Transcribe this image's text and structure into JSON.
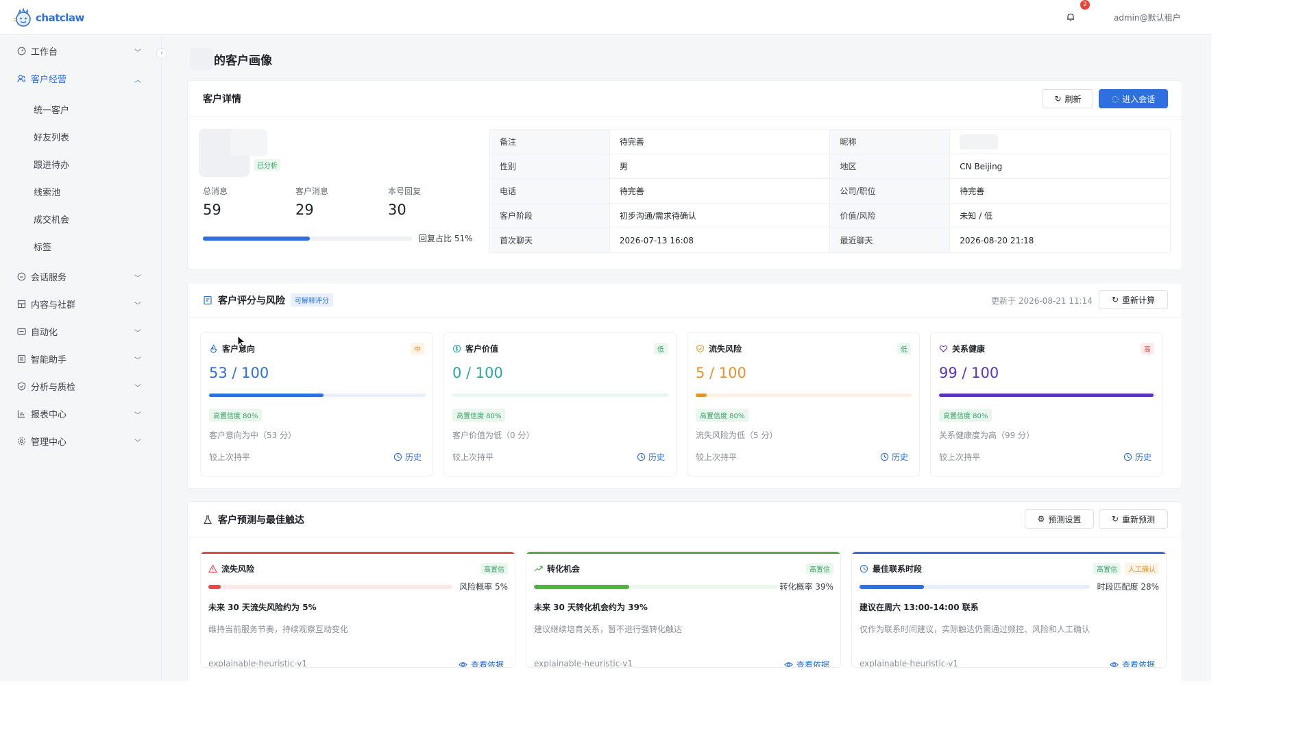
{
  "header": {
    "brand": "chatclaw",
    "notification_count": "2",
    "user": "admin@默认租户"
  },
  "sidebar": {
    "groups": [
      {
        "label": "工作台",
        "icon": "dashboard-icon"
      },
      {
        "label": "客户经营",
        "icon": "customers-icon"
      },
      {
        "label": "会话服务",
        "icon": "chat-icon"
      },
      {
        "label": "内容与社群",
        "icon": "community-icon"
      },
      {
        "label": "自动化",
        "icon": "automation-icon"
      },
      {
        "label": "智能助手",
        "icon": "assistant-icon"
      },
      {
        "label": "分析与质检",
        "icon": "shield-check-icon"
      },
      {
        "label": "报表中心",
        "icon": "bar-chart-icon"
      },
      {
        "label": "管理中心",
        "icon": "gear-icon"
      }
    ],
    "sub_items": [
      "统一客户",
      "好友列表",
      "跟进待办",
      "线索池",
      "成交机会",
      "标签"
    ]
  },
  "page": {
    "title": "的客户画像"
  },
  "detail": {
    "title": "客户详情",
    "refresh": "刷新",
    "enter_chat": "进入会话",
    "analyzed_badge": "已分析",
    "stats": [
      {
        "label": "总消息",
        "value": "59"
      },
      {
        "label": "客户消息",
        "value": "29"
      },
      {
        "label": "本号回复",
        "value": "30"
      }
    ],
    "reply_ratio": 0.51,
    "reply_ratio_text": "回复占比 51%",
    "rows": [
      {
        "k1": "备注",
        "v1": "待完善",
        "k2": "昵称",
        "v2": ""
      },
      {
        "k1": "性别",
        "v1": "男",
        "k2": "地区",
        "v2": "CN Beijing"
      },
      {
        "k1": "电话",
        "v1": "待完善",
        "k2": "公司/职位",
        "v2": "待完善"
      },
      {
        "k1": "客户阶段",
        "v1": "初步沟通/需求待确认",
        "k2": "价值/风险",
        "v2": "未知 / 低"
      },
      {
        "k1": "首次聊天",
        "v1": "2026-07-13 16:08",
        "k2": "最近聊天",
        "v2": "2026-08-20 21:18"
      }
    ]
  },
  "scores": {
    "title": "客户评分与风险",
    "tag": "可解释评分",
    "updated": "更新于 2026-08-21 11:14",
    "recalc": "重新计算",
    "items": [
      {
        "title": "客户意向",
        "icon": "flame-icon",
        "level": "中",
        "level_color": "#e8912d",
        "level_bg": "#fdf3e6",
        "value": "53 / 100",
        "score": 0.53,
        "color": "#2f6fe0",
        "track": "#e8eefb",
        "confidence": "高置信度 80%",
        "desc": "客户意向为中（53 分）",
        "compare": "较上次持平",
        "history": "历史"
      },
      {
        "title": "客户价值",
        "icon": "coin-icon",
        "level": "低",
        "level_color": "#38a169",
        "level_bg": "#eaf7ee",
        "value": "0 / 100",
        "score": 0.0,
        "color": "#2ea6a0",
        "track": "#e8f6f5",
        "confidence": "高置信度 80%",
        "desc": "客户价值为低（0 分）",
        "compare": "较上次持平",
        "history": "历史"
      },
      {
        "title": "流失风险",
        "icon": "shield-icon",
        "level": "低",
        "level_color": "#38a169",
        "level_bg": "#eaf7ee",
        "value": "5 / 100",
        "score": 0.05,
        "color": "#e8912d",
        "track": "#fdf1e4",
        "confidence": "高置信度 80%",
        "desc": "流失风险为低（5 分）",
        "compare": "较上次持平",
        "history": "历史"
      },
      {
        "title": "关系健康",
        "icon": "heart-icon",
        "level": "高",
        "level_color": "#e5484d",
        "level_bg": "#fdecec",
        "value": "99 / 100",
        "score": 0.99,
        "color": "#5b34c4",
        "track": "#efeafb",
        "confidence": "高置信度 80%",
        "desc": "关系健康度为高（99 分）",
        "compare": "较上次持平",
        "history": "历史"
      }
    ]
  },
  "prediction": {
    "title": "客户预测与最佳触达",
    "settings": "预测设置",
    "repredict": "重新预测",
    "items": [
      {
        "title": "流失风险",
        "icon": "warning-icon",
        "top_color": "#e5484d",
        "tags": [
          {
            "text": "高置信",
            "color": "#38a169",
            "bg": "#eaf7ee"
          }
        ],
        "prob": 0.05,
        "prob_text": "风险概率 5%",
        "fill": "#e5484d",
        "track": "#fbe9ea",
        "headline": "未来 30 天流失风险约为 5%",
        "desc": "维持当前服务节奏，持续观察互动变化",
        "model": "explainable-heuristic-v1",
        "link": "查看依据"
      },
      {
        "title": "转化机会",
        "icon": "trend-up-icon",
        "top_color": "#52b043",
        "tags": [
          {
            "text": "高置信",
            "color": "#38a169",
            "bg": "#eaf7ee"
          }
        ],
        "prob": 0.39,
        "prob_text": "转化概率 39%",
        "fill": "#52b043",
        "track": "#ecf6ea",
        "headline": "未来 30 天转化机会约为 39%",
        "desc": "建议继续培育关系，暂不进行强转化触达",
        "model": "explainable-heuristic-v1",
        "link": "查看依据"
      },
      {
        "title": "最佳联系时段",
        "icon": "clock-icon",
        "top_color": "#2f6fe0",
        "tags": [
          {
            "text": "高置信",
            "color": "#38a169",
            "bg": "#eaf7ee"
          },
          {
            "text": "人工确认",
            "color": "#e8912d",
            "bg": "#fdf3e6"
          }
        ],
        "prob": 0.28,
        "prob_text": "时段匹配度 28%",
        "fill": "#2f6fe0",
        "track": "#e8eefb",
        "headline": "建议在周六 13:00-14:00 联系",
        "desc": "仅作为联系时间建议，实际触达仍需通过频控、风险和人工确认",
        "model": "explainable-heuristic-v1",
        "link": "查看依据"
      }
    ]
  }
}
